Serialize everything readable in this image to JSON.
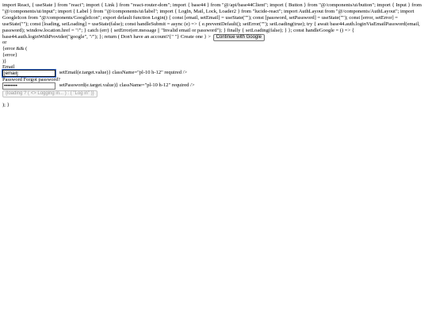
{
  "source_text": {
    "imports_block": "import React, { useState } from \"react\"; import { Link } from \"react-router-dom\"; import { base44 } from \"@/api/base44Client\"; import { Button } from \"@/components/ui/button\"; import { Input } from \"@/components/ui/input\"; import { Label } from \"@/components/ui/label\"; import { LogIn, Mail, Lock, Loader2 } from \"lucide-react\"; import AuthLayout from \"@/components/AuthLayout\"; import GoogleIcon from \"@/components/GoogleIcon\"; export default function Login() { const [email, setEmail] = useState(\"\"); const [password, setPassword] = useState(\"\"); const [error, setError] = useState(\"\"); const [loading, setLoading] = useState(false); const handleSubmit = async (e) => { e.preventDefault(); setError(\"\"); setLoading(true); try { await base44.auth.loginViaEmailPassword(email, password); window.location.href = \"/\"; } catch (err) { setError(err.message || \"Invalid email or password\"); } finally { setLoading(false); } }; const handleGoogle = () => { base44.auth.loginWithProvider(\"google\", \"/\"); }; return ( Don't have an account?{\" \"} Create one } >",
    "or_text": "or",
    "error_open": "{error && (",
    "error_expr": "{error}",
    "error_close": ")}",
    "email_label": "Email",
    "email_handler": "setEmail(e.target.value)} className=\"pl-10 h-12\" required />",
    "password_row": "Password Forgot password?",
    "password_handler": "setPassword(e.target.value)} className=\"pl-10 h-12\" required />",
    "closing": "); }"
  },
  "buttons": {
    "google_label": "Continue with Google",
    "login_label": "{loading ? ( <> Logging in... ) : ( \"Log in\" )}"
  },
  "inputs": {
    "email_value": "[email]",
    "password_value": "••••••••"
  }
}
